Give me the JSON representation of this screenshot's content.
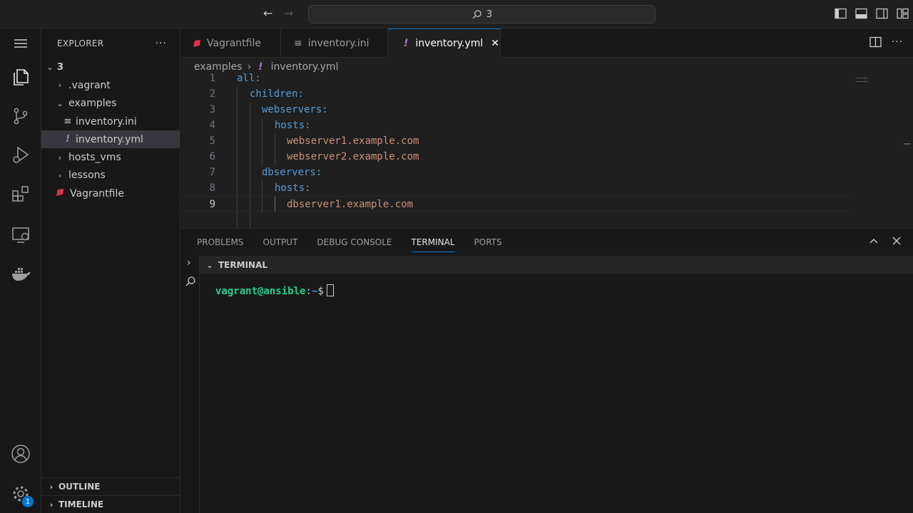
{
  "titlebar": {
    "search_text": "3",
    "back_label": "←",
    "forward_label": "→"
  },
  "activitybar": {
    "settings_badge": "1"
  },
  "sidebar": {
    "title": "EXPLORER",
    "more_label": "···",
    "tree": [
      {
        "label": "3",
        "type": "folder-open",
        "indent": 0
      },
      {
        "label": ".vagrant",
        "type": "folder",
        "indent": 1
      },
      {
        "label": "examples",
        "type": "folder-open",
        "indent": 1
      },
      {
        "label": "inventory.ini",
        "type": "ini",
        "indent": 2
      },
      {
        "label": "inventory.yml",
        "type": "yaml",
        "indent": 2,
        "selected": true
      },
      {
        "label": "hosts_vms",
        "type": "folder",
        "indent": 1
      },
      {
        "label": "lessons",
        "type": "folder",
        "indent": 1
      },
      {
        "label": "Vagrantfile",
        "type": "ruby",
        "indent": 1
      }
    ],
    "outline_label": "OUTLINE",
    "timeline_label": "TIMELINE"
  },
  "tabs": [
    {
      "label": "Vagrantfile",
      "icon": "ruby-icon",
      "active": false
    },
    {
      "label": "inventory.ini",
      "icon": "ini-icon",
      "active": false
    },
    {
      "label": "inventory.yml",
      "icon": "yaml-icon",
      "active": true
    }
  ],
  "tab_close": "✕",
  "breadcrumb": {
    "folder": "examples",
    "separator": "›",
    "file": "inventory.yml",
    "file_icon": "!"
  },
  "editor": {
    "lines": [
      {
        "num": "1",
        "key": "all:",
        "value": ""
      },
      {
        "num": "2",
        "key": "children:",
        "value": ""
      },
      {
        "num": "3",
        "key": "webservers:",
        "value": ""
      },
      {
        "num": "4",
        "key": "hosts:",
        "value": ""
      },
      {
        "num": "5",
        "key": "",
        "value": "webserver1.example.com"
      },
      {
        "num": "6",
        "key": "",
        "value": "webserver2.example.com"
      },
      {
        "num": "7",
        "key": "dbservers:",
        "value": ""
      },
      {
        "num": "8",
        "key": "hosts:",
        "value": ""
      },
      {
        "num": "9",
        "key": "",
        "value": "dbserver1.example.com"
      }
    ]
  },
  "panel": {
    "tabs": [
      "PROBLEMS",
      "OUTPUT",
      "DEBUG CONSOLE",
      "TERMINAL",
      "PORTS"
    ],
    "active_tab": "TERMINAL",
    "terminal_header": "TERMINAL",
    "prompt_user": "vagrant@ansible",
    "prompt_colon": ":",
    "prompt_path": "~",
    "prompt_symbol": "$"
  },
  "colors": {
    "accent": "#0078d4",
    "yaml_key": "#569cd6",
    "yaml_string": "#ce9178",
    "yaml_icon": "#b180d7",
    "ruby_icon": "#e0314b",
    "prompt_user": "#23d18b"
  }
}
